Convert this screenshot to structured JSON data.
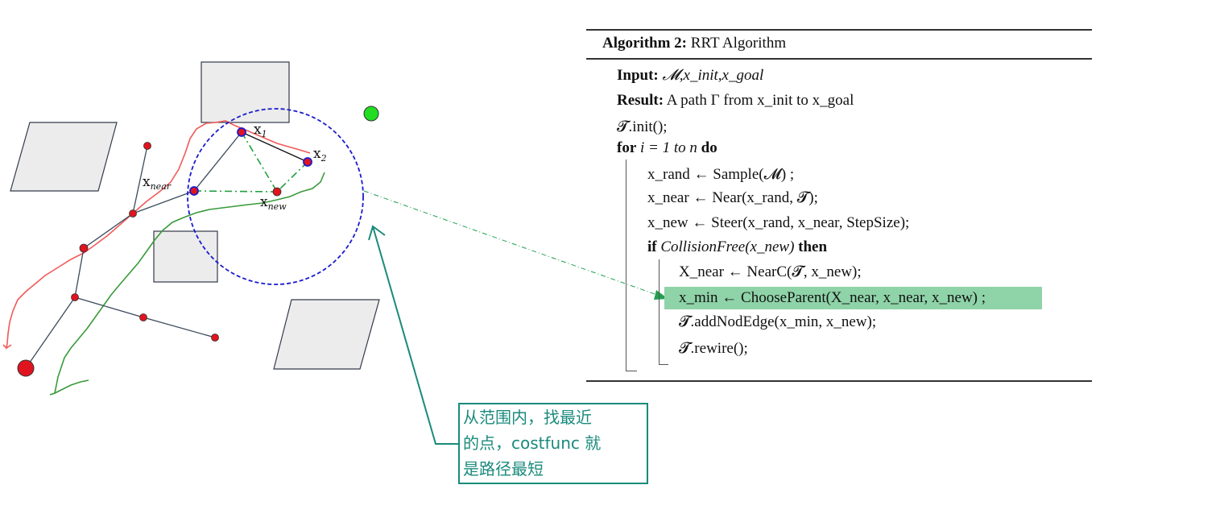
{
  "diagram": {
    "labels": {
      "x1": "x",
      "x1_sub": "1",
      "x2": "x",
      "x2_sub": "2",
      "xnear": "x",
      "xnear_sub": "near",
      "xnew": "x",
      "xnew_sub": "new"
    },
    "colors": {
      "node": "#e0141e",
      "obstacle_fill": "#ececec",
      "circle": "#1a1ad0",
      "red_path": "#f05a5a",
      "green_path": "#3a9a3a",
      "goal": "#22dd22",
      "annotation": "#1a8a7c"
    }
  },
  "algorithm": {
    "title_bold": "Algorithm 2:",
    "title_rest": " RRT Algorithm",
    "input_kw": "Input:",
    "input_text": " 𝓜,x_init,x_goal",
    "result_kw": "Result:",
    "result_text": " A path Γ from x_init to x_goal",
    "init_line": "𝓣.init();",
    "for_kw": "for",
    "for_mid": " i = 1 to n ",
    "for_do": "do",
    "l_rand": "x_rand ← Sample(𝓜) ;",
    "l_near": "x_near ← Near(x_rand, 𝓣);",
    "l_new": "x_new ← Steer(x_rand, x_near, StepSize);",
    "if_kw": "if",
    "if_mid": " CollisionFree(x_new) ",
    "if_then": "then",
    "l_Xnear": "X_near ← NearC(𝓣, x_new);",
    "l_min": "x_min ← ChooseParent(X_near, x_near, x_new) ;",
    "l_add": "𝓣.addNodEdge(x_min, x_new);",
    "l_rewire": "𝓣.rewire();"
  },
  "note": {
    "text_1": "从范围内，找最近",
    "text_2": "的点，costfunc 就",
    "text_3": "是路径最短"
  }
}
